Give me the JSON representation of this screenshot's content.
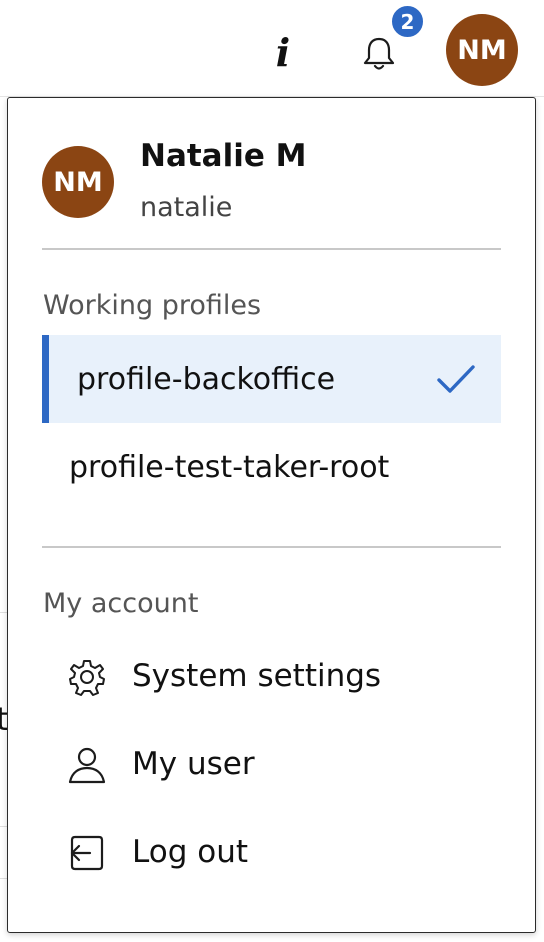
{
  "topbar": {
    "info_icon": "info-icon",
    "info_glyph": "i",
    "bell_icon": "bell-icon",
    "notification_count": "2",
    "avatar_initials": "NM",
    "accent_color": "#2d68c4",
    "avatar_color": "#8b4513"
  },
  "background_page": {
    "fragment_text": "t"
  },
  "user_menu": {
    "avatar_initials": "NM",
    "name": "Natalie M",
    "login": "natalie",
    "working_profiles": {
      "label": "Working profiles",
      "items": [
        {
          "label": "profile-backoffice",
          "selected": true,
          "icon": "check-icon"
        },
        {
          "label": "profile-test-taker-root",
          "selected": false
        }
      ]
    },
    "my_account": {
      "label": "My account",
      "items": [
        {
          "label": "System settings",
          "icon": "gear-icon"
        },
        {
          "label": "My user",
          "icon": "user-icon"
        },
        {
          "label": "Log out",
          "icon": "logout-icon"
        }
      ]
    }
  }
}
